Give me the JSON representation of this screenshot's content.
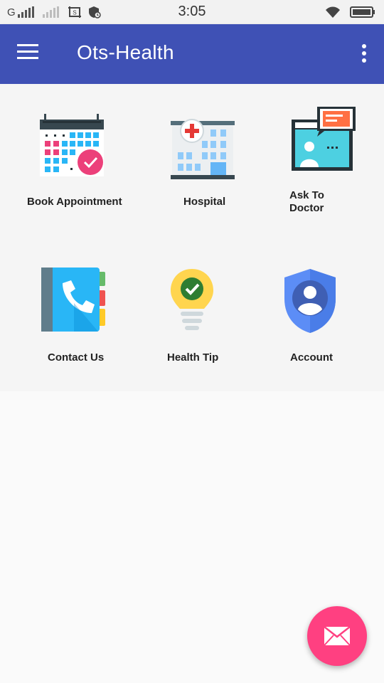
{
  "status_bar": {
    "network": "G",
    "time": "3:05"
  },
  "app_bar": {
    "title": "Ots-Health"
  },
  "menu": {
    "items": [
      {
        "label": "Book Appointment",
        "icon": "calendar-check-icon"
      },
      {
        "label": "Hospital",
        "icon": "hospital-building-icon"
      },
      {
        "label": "Ask To\nDoctor",
        "icon": "doctor-chat-icon"
      },
      {
        "label": "Contact Us",
        "icon": "phone-book-icon"
      },
      {
        "label": "Health Tip",
        "icon": "lightbulb-check-icon"
      },
      {
        "label": "Account",
        "icon": "account-shield-icon"
      }
    ]
  },
  "fab": {
    "icon": "mail-icon"
  },
  "colors": {
    "primary": "#3f51b5",
    "accent": "#ff4081",
    "background": "#fafafa"
  }
}
